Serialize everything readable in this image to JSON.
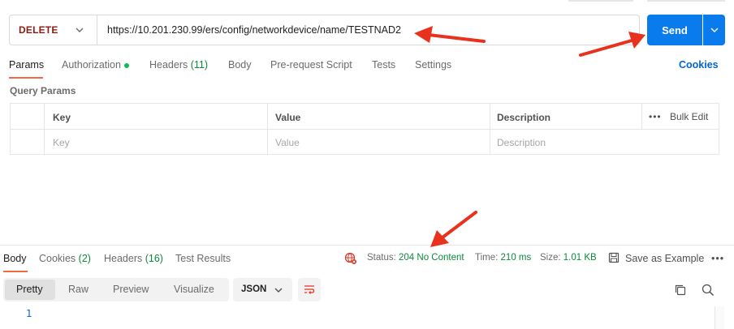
{
  "request": {
    "method": "DELETE",
    "url": "https://10.201.230.99/ers/config/networkdevice/name/TESTNAD2",
    "send_label": "Send"
  },
  "request_tabs": {
    "params": "Params",
    "authorization": "Authorization",
    "headers": "Headers",
    "headers_count": "(11)",
    "body": "Body",
    "pre_request": "Pre-request Script",
    "tests": "Tests",
    "settings": "Settings",
    "cookies": "Cookies"
  },
  "query_params": {
    "title": "Query Params",
    "columns": [
      "Key",
      "Value",
      "Description"
    ],
    "bulk_edit": "Bulk Edit",
    "placeholders": [
      "Key",
      "Value",
      "Description"
    ]
  },
  "response_tabs": {
    "body": "Body",
    "cookies": "Cookies",
    "cookies_count": "(2)",
    "headers": "Headers",
    "headers_count": "(16)",
    "test_results": "Test Results"
  },
  "response_status": {
    "status_label": "Status:",
    "status_value": "204 No Content",
    "time_label": "Time:",
    "time_value": "210 ms",
    "size_label": "Size:",
    "size_value": "1.01 KB",
    "save_example": "Save as Example"
  },
  "format_bar": {
    "pretty": "Pretty",
    "raw": "Raw",
    "preview": "Preview",
    "visualize": "Visualize",
    "format": "JSON"
  },
  "editor": {
    "line_number": "1"
  },
  "colors": {
    "accent_blue": "#097bed",
    "method_red": "#8e1a10",
    "tab_orange": "#f26b3a",
    "status_green": "#0a8a3a",
    "annotation_red": "#e8321e"
  }
}
